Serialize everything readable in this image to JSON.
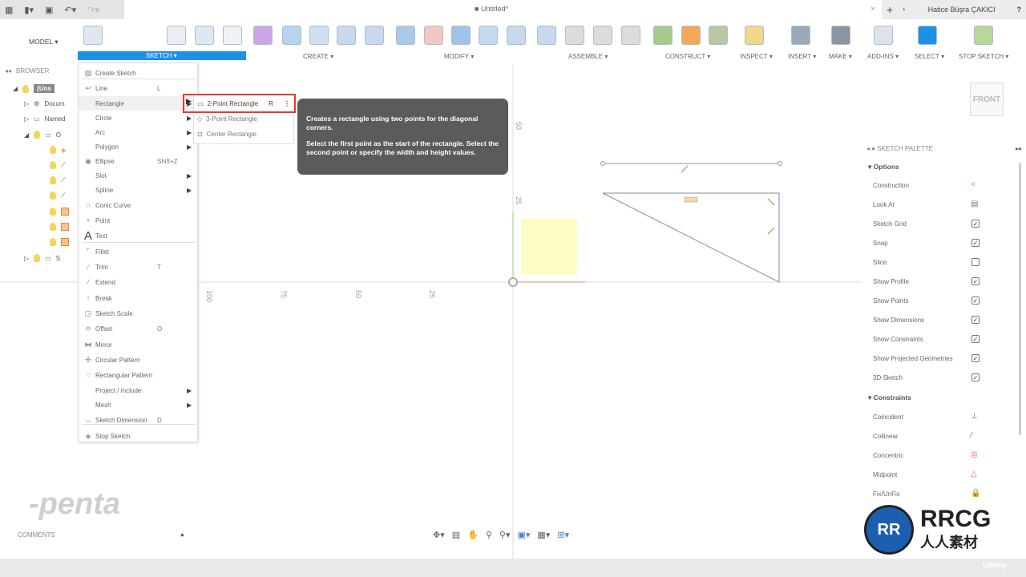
{
  "titlebar": {
    "document_title": "Untitled*",
    "user": "Hatice Büşra ÇAKICI",
    "help": "?"
  },
  "toolbar": {
    "workspace": "MODEL ▾",
    "groups": [
      {
        "label": "SKETCH ▾"
      },
      {
        "label": "CREATE ▾"
      },
      {
        "label": "MODIFY ▾"
      },
      {
        "label": "ASSEMBLE ▾"
      },
      {
        "label": "CONSTRUCT ▾"
      },
      {
        "label": "INSPECT ▾"
      },
      {
        "label": "INSERT ▾"
      },
      {
        "label": "MAKE ▾"
      },
      {
        "label": "ADD-INS ▾"
      },
      {
        "label": "SELECT ▾"
      },
      {
        "label": "STOP SKETCH ▾"
      }
    ],
    "accent": "#1e90e6"
  },
  "browser": {
    "title": "BROWSER",
    "rows": [
      {
        "label": "(Uns"
      },
      {
        "label": "Docum"
      },
      {
        "label": "Named"
      },
      {
        "label": "O"
      },
      {
        "label": "S"
      }
    ]
  },
  "sketch_menu": {
    "items": [
      {
        "label": "Create Sketch",
        "shortcut": ""
      },
      {
        "label": "Line",
        "shortcut": "L"
      },
      {
        "label": "Rectangle",
        "shortcut": ""
      },
      {
        "label": "Circle",
        "shortcut": ""
      },
      {
        "label": "Arc",
        "shortcut": ""
      },
      {
        "label": "Polygon",
        "shortcut": ""
      },
      {
        "label": "Ellipse",
        "shortcut": "Shift+Z"
      },
      {
        "label": "Slot",
        "shortcut": ""
      },
      {
        "label": "Spline",
        "shortcut": ""
      },
      {
        "label": "Conic Curve",
        "shortcut": ""
      },
      {
        "label": "Point",
        "shortcut": ""
      },
      {
        "label": "Text",
        "shortcut": ""
      },
      {
        "label": "Fillet",
        "shortcut": ""
      },
      {
        "label": "Trim",
        "shortcut": "T"
      },
      {
        "label": "Extend",
        "shortcut": ""
      },
      {
        "label": "Break",
        "shortcut": ""
      },
      {
        "label": "Sketch Scale",
        "shortcut": ""
      },
      {
        "label": "Offset",
        "shortcut": "O"
      },
      {
        "label": "Mirror",
        "shortcut": ""
      },
      {
        "label": "Circular Pattern",
        "shortcut": ""
      },
      {
        "label": "Rectangular Pattern",
        "shortcut": ""
      },
      {
        "label": "Project / Include",
        "shortcut": ""
      },
      {
        "label": "Mesh",
        "shortcut": ""
      },
      {
        "label": "Sketch Dimension",
        "shortcut": "D"
      },
      {
        "label": "Stop Sketch",
        "shortcut": ""
      }
    ]
  },
  "rectangle_submenu": {
    "items": [
      {
        "label": "2-Point Rectangle",
        "shortcut": "R"
      },
      {
        "label": "3-Point Rectangle"
      },
      {
        "label": "Center Rectangle"
      }
    ]
  },
  "tooltip": {
    "line1": "Creates a rectangle using two points for the diagonal corners.",
    "line2": "Select the first point as the start of the rectangle. Select the second point or specify the width and height values."
  },
  "canvas": {
    "h_ticks": [
      "100",
      "75",
      "50",
      "25"
    ],
    "v_ticks": [
      "50",
      "25"
    ],
    "viewcube": "FRONT"
  },
  "palette": {
    "title": "SKETCH PALETTE",
    "options_header": "Options",
    "options": [
      {
        "label": "Construction",
        "type": "icon"
      },
      {
        "label": "Look At",
        "type": "icon"
      },
      {
        "label": "Sketch Grid",
        "checked": true
      },
      {
        "label": "Snap",
        "checked": true
      },
      {
        "label": "Slice",
        "checked": false
      },
      {
        "label": "Show Profile",
        "checked": true
      },
      {
        "label": "Show Points",
        "checked": true
      },
      {
        "label": "Show Dimensions",
        "checked": true
      },
      {
        "label": "Show Constraints",
        "checked": true
      },
      {
        "label": "Show Projected Geometries",
        "checked": true
      },
      {
        "label": "3D Sketch",
        "checked": true
      }
    ],
    "constraints_header": "Constraints",
    "constraints": [
      {
        "label": "Coincident"
      },
      {
        "label": "Collinear"
      },
      {
        "label": "Concentric"
      },
      {
        "label": "Midpoint"
      },
      {
        "label": "Fix/UnFix"
      }
    ]
  },
  "bottom": {
    "comments": "COMMENTS"
  },
  "watermarks": {
    "penta_logo": "-penta",
    "rrcg": "RRCG",
    "rrcg_sub": "人人素材",
    "udemy": "Udemy"
  }
}
